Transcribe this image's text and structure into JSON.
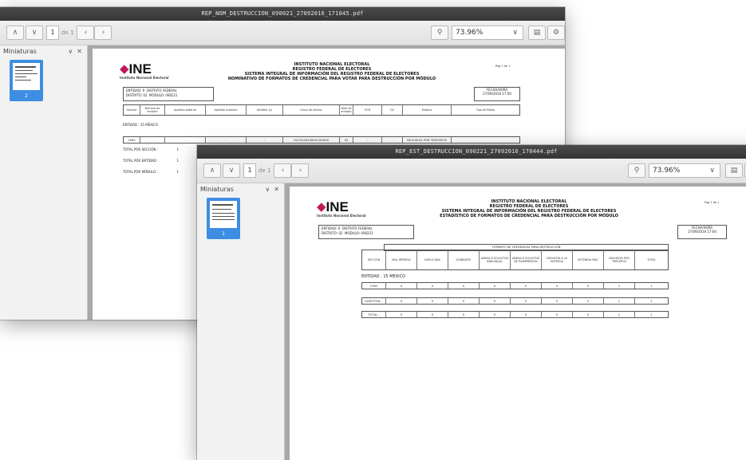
{
  "window1": {
    "title": "REP_NOM_DESTRUCCION_090021_27092016_171045.pdf",
    "page_current": "1",
    "page_of": "de 1",
    "zoom": "73.96%",
    "sidebar_title": "Miniaturas",
    "thumb_label": "2",
    "doc": {
      "logo": "INE",
      "logo_sub": "Instituto Nacional Electoral",
      "heading": [
        "INSTITUTO NACIONAL ELECTORAL",
        "REGISTRO FEDERAL DE ELECTORES",
        "SISTEMA INTEGRAL DE INFORMACIÓN DEL REGISTRO FEDERAL DE ELECTORES",
        "NOMINATIVO DE FORMATOS DE CREDENCIAL PARA VOTAR PARA DESTRUCCIÓN POR MÓDULO"
      ],
      "page_note": "Pag 1 de 1",
      "entidad_label": "ENTIDAD:",
      "entidad_num": "9",
      "entidad_name": "DISTRITO FEDERAL",
      "distrito_label": "DISTRITO:",
      "distrito_num": "02",
      "modulo_label": "MÓDULO:",
      "modulo_num": "090221",
      "fecha_label": "FECHA/HORA",
      "fecha_value": "27/09/2016 17:00",
      "columns": [
        "Sección",
        "Número de emisión",
        "Apellido paterno",
        "Apellido materno",
        "Nombre (s)",
        "Clave de elector",
        "Núm de emisión",
        "OCR",
        "CIC",
        "Estatus",
        "Tipo de Retiro"
      ],
      "entidad_line": "ENTIDAD :   15 MÉXICO",
      "row": [
        "1962",
        "-",
        "-",
        "-",
        "-",
        "GLCSLS87080915H900",
        "02",
        "-",
        "-",
        "DEVUELTA POR TERCEROS",
        "-"
      ],
      "totals": [
        {
          "label": "TOTAL POR SECCIÓN :",
          "value": "1"
        },
        {
          "label": "TOTAL POR ENTIDAD :",
          "value": "1"
        },
        {
          "label": "TOTAL POR MÓDULO :",
          "value": "1"
        }
      ]
    }
  },
  "window2": {
    "title": "REP_EST_DESTRUCCION_090221_27092016_170444.pdf",
    "page_current": "1",
    "page_of": "de 1",
    "zoom": "73.96%",
    "sidebar_title": "Miniaturas",
    "thumb_label": "1",
    "doc": {
      "logo": "INE",
      "logo_sub": "Instituto Nacional Electoral",
      "heading": [
        "INSTITUTO NACIONAL ELECTORAL",
        "REGISTRO FEDERAL DE ELECTORES",
        "SISTEMA INTEGRAL DE INFORMACIÓN DEL REGISTRO FEDERAL DE ELECTORES",
        "ESTADÍSTICO DE FORMATOS DE CREDENCIAL PARA DESTRUCCIÓN POR MÓDULO"
      ],
      "page_note": "Pag 1 de 1",
      "entidad_label": "ENTIDAD:",
      "entidad_num": "9",
      "entidad_name": "DISTRITO FEDERAL",
      "distrito_label": "DISTRITO:",
      "distrito_num": "02",
      "modulo_label": "MÓDULO:",
      "modulo_num": "090221",
      "fecha_label": "FECHA/HORA",
      "fecha_value": "27/09/2016 17:04",
      "group_header": "FORMATO DE CREDENCIAL PARA DESTRUCCIÓN",
      "columns": [
        "SECCIÓN",
        "MAL IMPRESA",
        "DUPLICADA",
        "SOBRANTE",
        "ANEXA A SOLICITUD INDIVIDUAL",
        "ANEXA A SOLICITUD DE REIMPRESIÓN",
        "DEVUELTA A LA ENTREGA",
        "RETENIDA MAC",
        "DEVUELTA POR TERCEROS",
        "TOTAL"
      ],
      "entidad_line": "ENTIDAD :   15 MEXICO",
      "rows": [
        [
          "1962",
          "0",
          "0",
          "0",
          "0",
          "0",
          "0",
          "0",
          "1",
          "1"
        ],
        [
          "SUBTOTAL :",
          "0",
          "0",
          "0",
          "0",
          "0",
          "0",
          "0",
          "1",
          "1"
        ],
        [
          "TOTAL :",
          "0",
          "0",
          "0",
          "0",
          "0",
          "0",
          "0",
          "1",
          "1"
        ]
      ]
    }
  }
}
